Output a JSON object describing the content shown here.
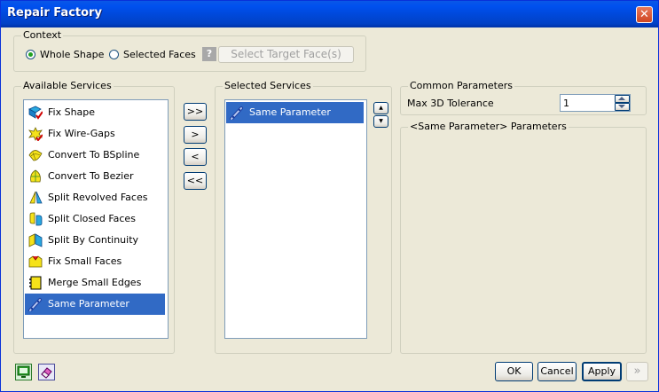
{
  "window": {
    "title": "Repair Factory",
    "close_glyph": "✕"
  },
  "context": {
    "label": "Context",
    "whole_shape": "Whole Shape",
    "selected_faces": "Selected Faces",
    "selected": "whole_shape",
    "target_button": "Select Target Face(s)",
    "help_glyph": "?"
  },
  "available": {
    "label": "Available Services",
    "items": [
      {
        "label": "Fix Shape",
        "icon": "fix-shape-icon"
      },
      {
        "label": "Fix Wire-Gaps",
        "icon": "fix-wire-gaps-icon"
      },
      {
        "label": "Convert To BSpline",
        "icon": "convert-bspline-icon"
      },
      {
        "label": "Convert To Bezier",
        "icon": "convert-bezier-icon"
      },
      {
        "label": "Split Revolved Faces",
        "icon": "split-revolved-icon"
      },
      {
        "label": "Split Closed Faces",
        "icon": "split-closed-icon"
      },
      {
        "label": "Split By Continuity",
        "icon": "split-continuity-icon"
      },
      {
        "label": "Fix Small Faces",
        "icon": "fix-small-faces-icon"
      },
      {
        "label": "Merge Small Edges",
        "icon": "merge-small-edges-icon"
      },
      {
        "label": "Same Parameter",
        "icon": "same-parameter-icon"
      }
    ],
    "selected_index": 9
  },
  "transfer": {
    "add_all": ">>",
    "add": ">",
    "remove": "<",
    "remove_all": "<<"
  },
  "selected_services": {
    "label": "Selected Services",
    "items": [
      {
        "label": "Same Parameter",
        "icon": "same-parameter-icon"
      }
    ],
    "up_glyph": "▲",
    "down_glyph": "▼"
  },
  "common": {
    "label": "Common Parameters",
    "tolerance_label": "Max 3D Tolerance",
    "tolerance_value": "1"
  },
  "params": {
    "label": "<Same Parameter> Parameters"
  },
  "footer": {
    "ok": "OK",
    "cancel": "Cancel",
    "apply": "Apply",
    "next_glyph": "»"
  },
  "colors": {
    "titlebar": "#0054e3",
    "selection": "#316ac5",
    "face_blue": "#29a8e0",
    "face_yellow": "#f5e21a"
  }
}
